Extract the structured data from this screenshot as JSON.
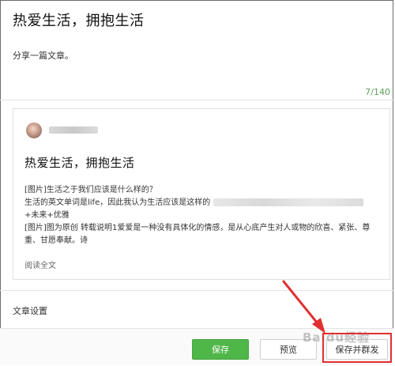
{
  "editor": {
    "title": "热爱生活，拥抱生活",
    "summary": "分享一篇文章。",
    "char_counter": "7/140"
  },
  "card": {
    "title": "热爱生活，拥抱生活",
    "lines": [
      "[图片]生活之于我们应该是什么样的？",
      "生活的英文单词是life，因此我认为生活应该是这样的",
      "+未来+优雅",
      "[图片]图为原创 转载说明1爱爱是一种没有具体化的情感，是从心底产生对人或物的欣喜、紧张、尊",
      "重、甘愿奉献。诗"
    ],
    "read_more": "阅读全文"
  },
  "settings_label": "文章设置",
  "buttons": {
    "save": "保存",
    "preview": "预览",
    "save_and_publish": "保存并群发"
  },
  "annotation": {
    "highlight_color": "#e03030",
    "watermark": "Baidu经验"
  },
  "colors": {
    "accent_green": "#4fb648",
    "counter_green": "#5aa05a"
  }
}
